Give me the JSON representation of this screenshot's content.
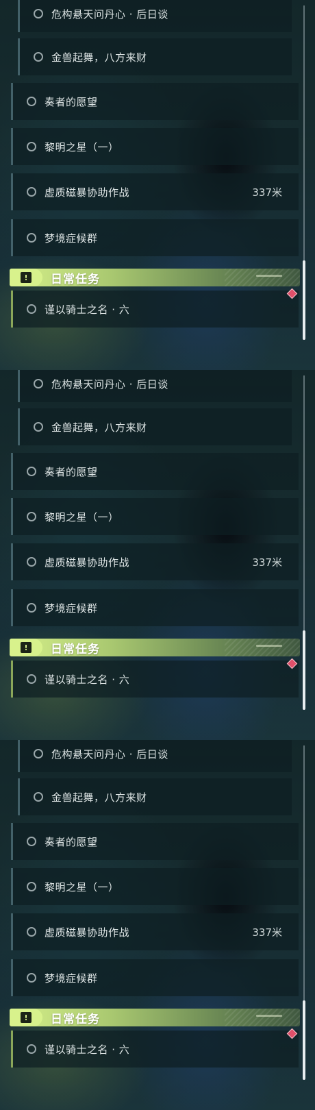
{
  "quests": {
    "q1": {
      "label": "危构悬天问丹心 · 后日谈"
    },
    "q2": {
      "label": "金兽起舞，八方来财"
    },
    "q3": {
      "label": "奏者的愿望"
    },
    "q4": {
      "label": "黎明之星（一）"
    },
    "q5": {
      "label": "虚质磁暴协助作战",
      "distance": "337米"
    },
    "q6": {
      "label": "梦境症候群"
    }
  },
  "daily": {
    "title": "日常任务",
    "badge_glyph": "!",
    "item": {
      "label": "谨以骑士之名 · 六"
    }
  },
  "icons": {
    "section": "alert-square-icon",
    "marker": "diamond-marker-icon",
    "radio": "radio-circle-icon"
  },
  "colors": {
    "accent": "#d6f08a",
    "marker": "#e0506a",
    "text": "#dfe6e6"
  }
}
